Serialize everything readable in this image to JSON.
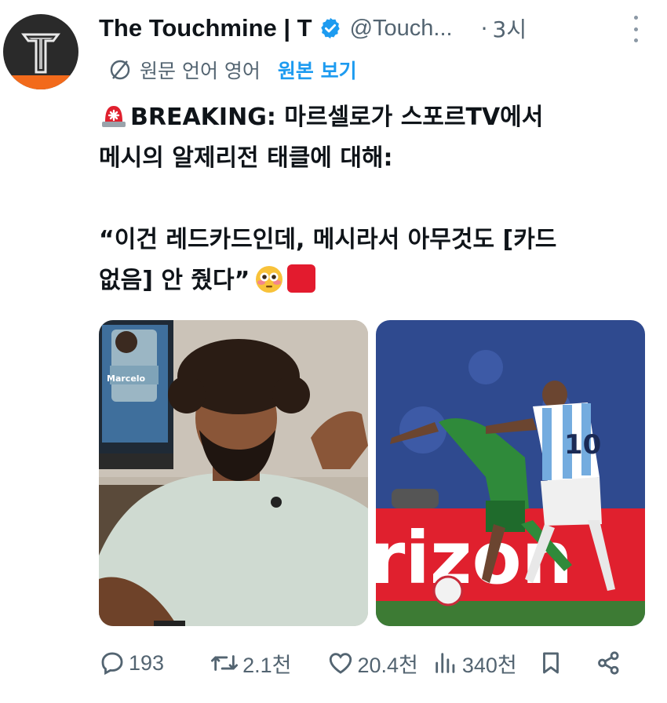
{
  "author": {
    "display_name": "The Touchmine | T",
    "handle": "@Touch...",
    "time_sep": "·",
    "time": "3시",
    "avatar_letter": "T"
  },
  "translation": {
    "label": "원문 언어 영어",
    "link": "원본 보기"
  },
  "tweet": {
    "line1": "BREAKING: 마르셀로가 스포르TV에서",
    "line2": "메시의 알제리전 태클에 대해:",
    "line3": "“이건 레드카드인데, 메시라서 아무것도 [카드",
    "line4": "없음] 안 줬다”"
  },
  "media": {
    "left_card_name": "Marcelo",
    "right_banner_text": "rizon",
    "jersey_number": "10"
  },
  "stats": {
    "replies": "193",
    "reposts": "2.1천",
    "likes": "20.4천",
    "views": "340천"
  },
  "colors": {
    "accent": "#1d9bf0",
    "secondary_text": "#536471",
    "green_kit": "#2f8a3a",
    "argentina_blue": "#74acdf"
  },
  "icons": [
    "verified-badge-icon",
    "more-icon",
    "translate-icon",
    "siren-emoji-icon",
    "flushed-emoji-icon",
    "red-square-emoji-icon",
    "reply-icon",
    "repost-icon",
    "like-icon",
    "views-icon",
    "bookmark-icon",
    "share-icon"
  ]
}
